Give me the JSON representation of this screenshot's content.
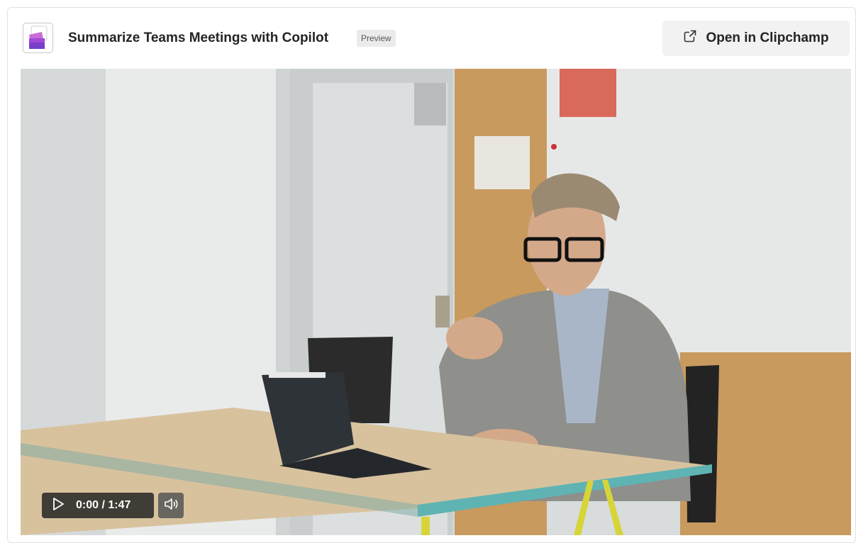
{
  "header": {
    "title": "Summarize Teams Meetings with Copilot",
    "badge": "Preview",
    "open_button_label": "Open in Clipchamp"
  },
  "player": {
    "time_display": "0:00 / 1:47",
    "current_time": "0:00",
    "duration": "1:47",
    "progress": 0
  },
  "icons": {
    "app": "clipchamp-app-icon",
    "open": "open-external-icon",
    "play": "play-icon",
    "volume": "volume-icon"
  },
  "colors": {
    "title_text": "#242424",
    "button_bg": "#f2f2f2",
    "control_bg": "#1e1e1e",
    "app_icon_purple": "#8a3fd1"
  }
}
